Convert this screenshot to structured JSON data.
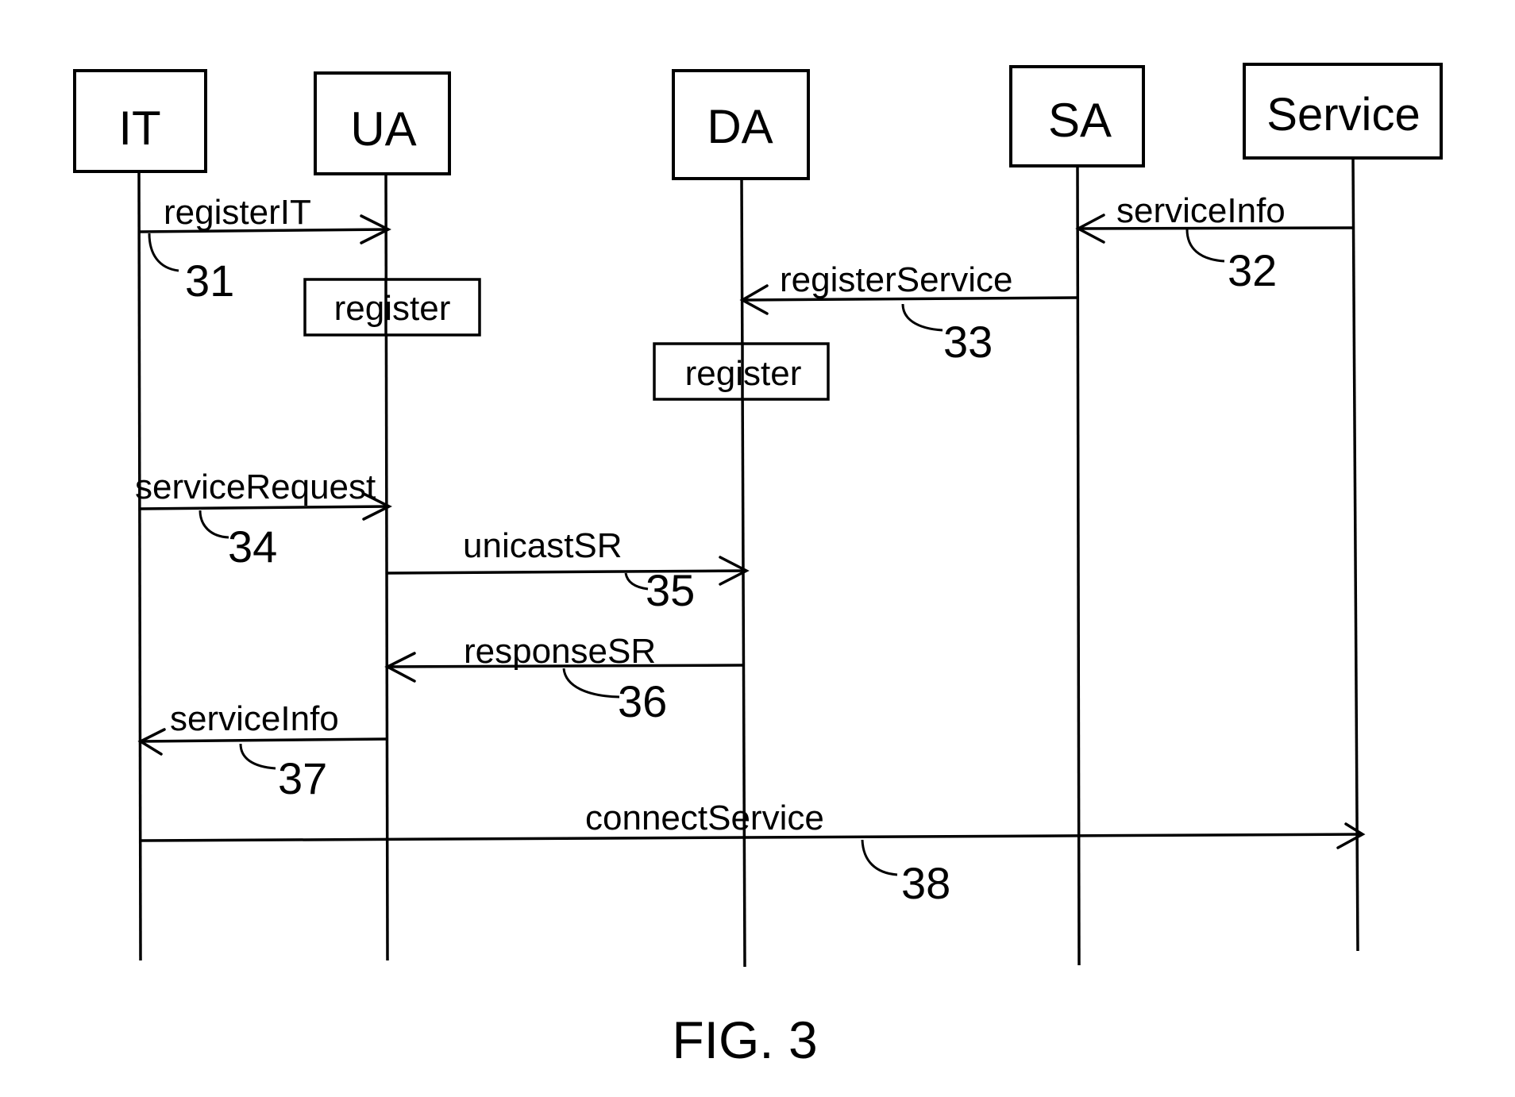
{
  "figure": {
    "caption": "FIG. 3",
    "type": "sequence-diagram"
  },
  "actors": [
    {
      "id": "IT",
      "label": "IT"
    },
    {
      "id": "UA",
      "label": "UA"
    },
    {
      "id": "DA",
      "label": "DA"
    },
    {
      "id": "SA",
      "label": "SA"
    },
    {
      "id": "Service",
      "label": "Service"
    }
  ],
  "notes": [
    {
      "actor": "UA",
      "label": "register"
    },
    {
      "actor": "DA",
      "label": "register"
    }
  ],
  "messages": [
    {
      "from": "IT",
      "to": "UA",
      "label": "registerIT",
      "ref": "31"
    },
    {
      "from": "Service",
      "to": "SA",
      "label": "serviceInfo",
      "ref": "32"
    },
    {
      "from": "SA",
      "to": "DA",
      "label": "registerService",
      "ref": "33"
    },
    {
      "from": "IT",
      "to": "UA",
      "label": "serviceRequest",
      "ref": "34"
    },
    {
      "from": "UA",
      "to": "DA",
      "label": "unicastSR",
      "ref": "35"
    },
    {
      "from": "DA",
      "to": "UA",
      "label": "responseSR",
      "ref": "36"
    },
    {
      "from": "UA",
      "to": "IT",
      "label": "serviceInfo",
      "ref": "37"
    },
    {
      "from": "IT",
      "to": "Service",
      "label": "connectService",
      "ref": "38"
    }
  ]
}
